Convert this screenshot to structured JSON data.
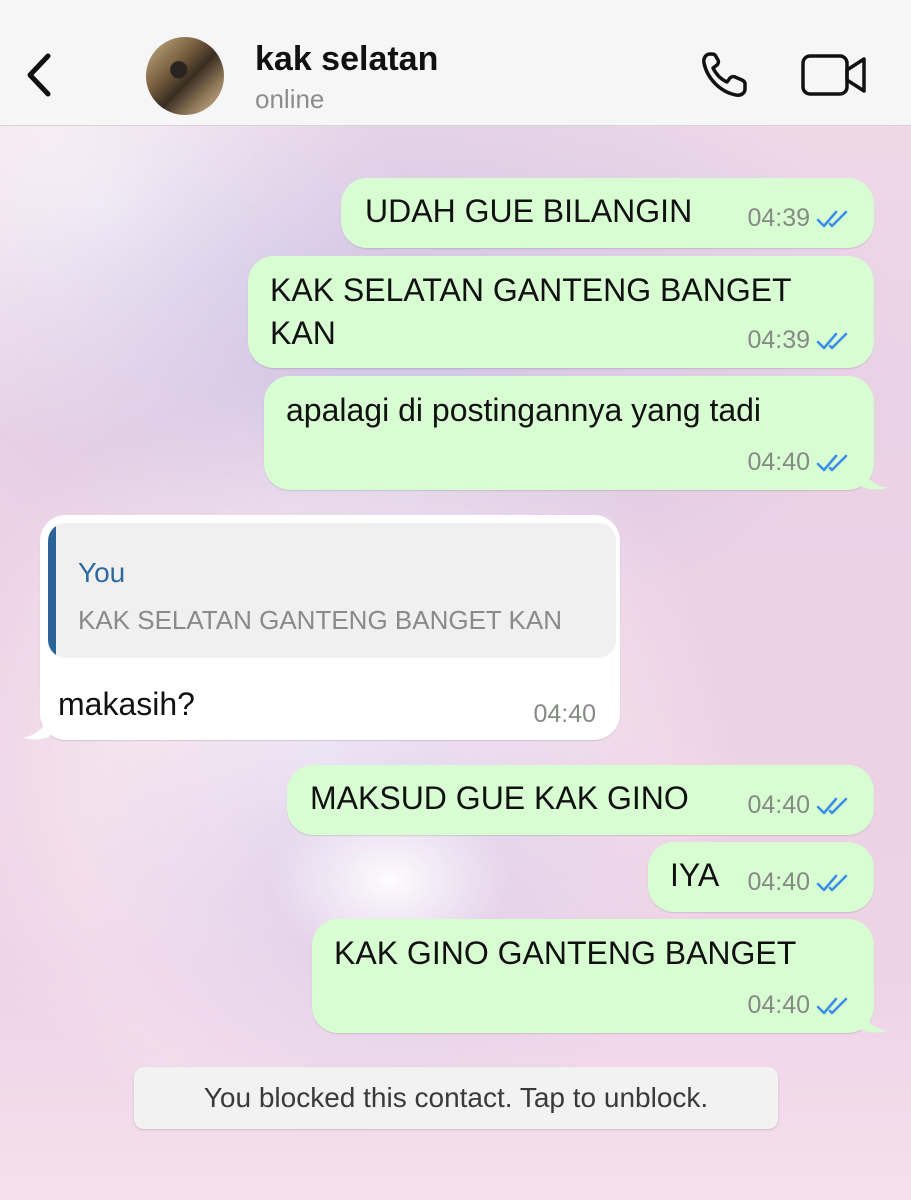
{
  "header": {
    "contact_name": "kak selatan",
    "status": "online"
  },
  "messages": [
    {
      "direction": "out",
      "text": "UDAH GUE BILANGIN",
      "time": "04:39",
      "read": true
    },
    {
      "direction": "out",
      "text": "KAK SELATAN GANTENG BANGET",
      "text_line2": "KAN",
      "time": "04:39",
      "read": true
    },
    {
      "direction": "out",
      "text": "apalagi di postingannya yang tadi",
      "time": "04:40",
      "read": true
    },
    {
      "direction": "in",
      "reply_to": {
        "author": "You",
        "text": "KAK SELATAN GANTENG BANGET KAN"
      },
      "text": "makasih?",
      "time": "04:40"
    },
    {
      "direction": "out",
      "text": "MAKSUD GUE KAK GINO",
      "time": "04:40",
      "read": true
    },
    {
      "direction": "out",
      "text": "IYA",
      "time": "04:40",
      "read": true
    },
    {
      "direction": "out",
      "text": "KAK GINO GANTENG BANGET",
      "time": "04:40",
      "read": true
    }
  ],
  "footer_notice": "You blocked this contact. Tap to unblock.",
  "colors": {
    "outgoing_bubble": "#d9fdd3",
    "incoming_bubble": "#ffffff",
    "read_ticks": "#3b8ee8",
    "quote_accent": "#2a6496"
  },
  "icons": [
    "chevron-left-icon",
    "phone-icon",
    "video-camera-icon",
    "double-check-icon"
  ]
}
